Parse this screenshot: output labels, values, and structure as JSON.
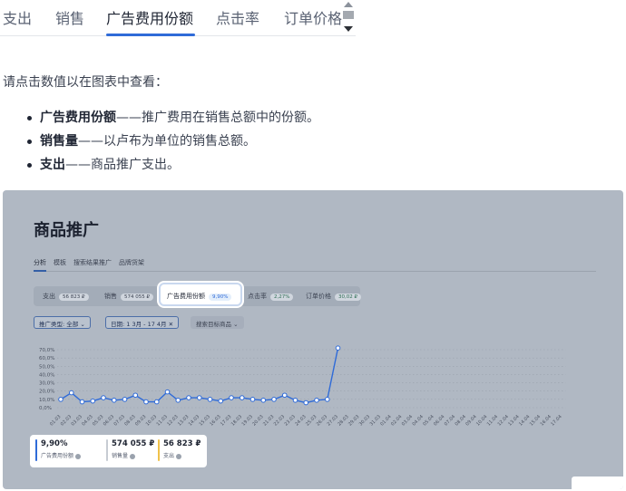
{
  "tabs": [
    {
      "label": "支出"
    },
    {
      "label": "销售"
    },
    {
      "label": "广告费用份额",
      "active": true
    },
    {
      "label": "点击率"
    },
    {
      "label": "订单价格"
    }
  ],
  "intro": "请点击数值以在图表中查看：",
  "bullets": [
    {
      "term": "广告费用份额",
      "desc": "——推广费用在销售总额中的份额。"
    },
    {
      "term": "销售量",
      "desc": "——以卢布为单位的销售总额。"
    },
    {
      "term": "支出",
      "desc": "——商品推广支出。"
    }
  ],
  "screenshot": {
    "title": "商品推广",
    "nav": [
      "分析",
      "模板",
      "搜索结果推广",
      "品牌货架"
    ],
    "metrics": {
      "spend": {
        "label": "支出",
        "value": "56 823 ₽"
      },
      "sales": {
        "label": "销售",
        "value": "574 055 ₽"
      },
      "share": {
        "label": "广告费用份额",
        "value": "9,90%"
      },
      "ctr": {
        "label": "点击率",
        "value": "2,27%"
      },
      "order": {
        "label": "订单价格",
        "value": "30,02 ₽"
      }
    },
    "filters": {
      "type": "推广类型: 全部 ⌄",
      "date": "日期: 1 3月 - 17 4月 ✕",
      "search": "搜索目标商品 ⌄"
    },
    "legend": {
      "share": {
        "value": "9,90%",
        "label": "广告费用份额"
      },
      "sales": {
        "value": "574 055 ₽",
        "label": "销售量"
      },
      "spend": {
        "value": "56 823 ₽",
        "label": "支出"
      }
    },
    "colors": {
      "share": "#2f6bd8",
      "sales": "#c7ccd3",
      "spend": "#f0c24a"
    }
  },
  "chart_data": {
    "type": "line",
    "x": [
      "01.03",
      "02.03",
      "03.03",
      "04.03",
      "05.03",
      "06.03",
      "07.03",
      "08.03",
      "09.03",
      "10.03",
      "11.03",
      "12.03",
      "13.03",
      "14.03",
      "15.03",
      "16.03",
      "17.03",
      "18.03",
      "19.03",
      "20.03",
      "21.03",
      "22.03",
      "23.03",
      "24.03",
      "25.03",
      "26.03",
      "27.03",
      "28.03",
      "29.03",
      "30.03",
      "31.03",
      "01.04",
      "02.04",
      "03.04",
      "04.04",
      "05.04",
      "06.04",
      "07.04",
      "08.04",
      "09.04",
      "10.04",
      "11.04",
      "12.04",
      "13.04",
      "14.04",
      "15.04",
      "16.04",
      "17.04"
    ],
    "series": [
      {
        "name": "广告费用份额",
        "values": [
          10,
          18,
          7,
          8,
          12,
          9,
          10,
          15,
          7,
          7,
          19,
          9,
          12,
          12,
          10,
          8,
          12,
          12,
          10,
          9,
          10,
          15,
          9,
          6,
          9,
          10,
          72
        ]
      }
    ],
    "ylim": [
      0,
      70
    ],
    "yticks": [
      "0,0%",
      "10,0%",
      "20,0%",
      "30,0%",
      "40,0%",
      "50,0%",
      "60,0%",
      "70,0%"
    ],
    "grid": true
  }
}
